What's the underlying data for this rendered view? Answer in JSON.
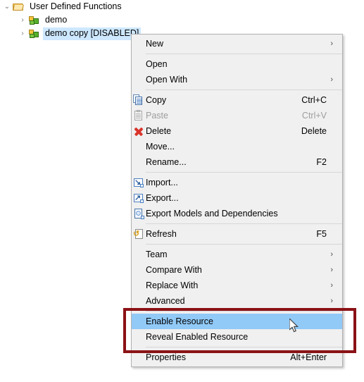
{
  "tree": {
    "rows": [
      {
        "label": "User Defined Functions",
        "icon": "folder-icon",
        "twisty": "⌄",
        "expanded": true,
        "level": 0,
        "selected": false
      },
      {
        "label": "demo",
        "icon": "function-icon",
        "twisty": "›",
        "expanded": false,
        "level": 1,
        "selected": false
      },
      {
        "label": "demo copy [DISABLED]",
        "icon": "function-icon",
        "twisty": "›",
        "expanded": false,
        "level": 1,
        "selected": true
      }
    ]
  },
  "context_menu": {
    "items": [
      {
        "type": "item",
        "label": "New",
        "accel": "",
        "icon": "",
        "arrow": true,
        "disabled": false,
        "highlighted": false
      },
      {
        "type": "separator"
      },
      {
        "type": "item",
        "label": "Open",
        "accel": "",
        "icon": "",
        "arrow": false,
        "disabled": false,
        "highlighted": false
      },
      {
        "type": "item",
        "label": "Open With",
        "accel": "",
        "icon": "",
        "arrow": true,
        "disabled": false,
        "highlighted": false
      },
      {
        "type": "separator"
      },
      {
        "type": "item",
        "label": "Copy",
        "accel": "Ctrl+C",
        "icon": "copy-icon",
        "arrow": false,
        "disabled": false,
        "highlighted": false
      },
      {
        "type": "item",
        "label": "Paste",
        "accel": "Ctrl+V",
        "icon": "paste-icon",
        "arrow": false,
        "disabled": true,
        "highlighted": false
      },
      {
        "type": "item",
        "label": "Delete",
        "accel": "Delete",
        "icon": "delete-icon",
        "arrow": false,
        "disabled": false,
        "highlighted": false
      },
      {
        "type": "item",
        "label": "Move...",
        "accel": "",
        "icon": "",
        "arrow": false,
        "disabled": false,
        "highlighted": false
      },
      {
        "type": "item",
        "label": "Rename...",
        "accel": "F2",
        "icon": "",
        "arrow": false,
        "disabled": false,
        "highlighted": false
      },
      {
        "type": "separator"
      },
      {
        "type": "item",
        "label": "Import...",
        "accel": "",
        "icon": "import-icon",
        "arrow": false,
        "disabled": false,
        "highlighted": false
      },
      {
        "type": "item",
        "label": "Export...",
        "accel": "",
        "icon": "export-icon",
        "arrow": false,
        "disabled": false,
        "highlighted": false
      },
      {
        "type": "item",
        "label": "Export Models and Dependencies",
        "accel": "",
        "icon": "export-models-icon",
        "arrow": false,
        "disabled": false,
        "highlighted": false
      },
      {
        "type": "separator"
      },
      {
        "type": "item",
        "label": "Refresh",
        "accel": "F5",
        "icon": "refresh-icon",
        "arrow": false,
        "disabled": false,
        "highlighted": false
      },
      {
        "type": "separator"
      },
      {
        "type": "item",
        "label": "Team",
        "accel": "",
        "icon": "",
        "arrow": true,
        "disabled": false,
        "highlighted": false
      },
      {
        "type": "item",
        "label": "Compare With",
        "accel": "",
        "icon": "",
        "arrow": true,
        "disabled": false,
        "highlighted": false
      },
      {
        "type": "item",
        "label": "Replace With",
        "accel": "",
        "icon": "",
        "arrow": true,
        "disabled": false,
        "highlighted": false
      },
      {
        "type": "item",
        "label": "Advanced",
        "accel": "",
        "icon": "",
        "arrow": true,
        "disabled": false,
        "highlighted": false
      },
      {
        "type": "separator"
      },
      {
        "type": "item",
        "label": "Enable Resource",
        "accel": "",
        "icon": "",
        "arrow": false,
        "disabled": false,
        "highlighted": true
      },
      {
        "type": "item",
        "label": "Reveal Enabled Resource",
        "accel": "",
        "icon": "",
        "arrow": false,
        "disabled": false,
        "highlighted": false
      },
      {
        "type": "separator"
      },
      {
        "type": "item",
        "label": "Properties",
        "accel": "Alt+Enter",
        "icon": "",
        "arrow": false,
        "disabled": false,
        "highlighted": false
      }
    ],
    "submenu_arrow_glyph": "›"
  },
  "annotation": {
    "name": "red-highlight-box",
    "color": "#8b1216"
  },
  "colors": {
    "menu_background": "#f0f0f0",
    "menu_border": "#b1b1b1",
    "highlight": "#91c9f7",
    "selection": "#cde8ff",
    "disabled_text": "#9d9d9d",
    "separator": "#d7d7d7",
    "annotation_red": "#8b1216"
  }
}
